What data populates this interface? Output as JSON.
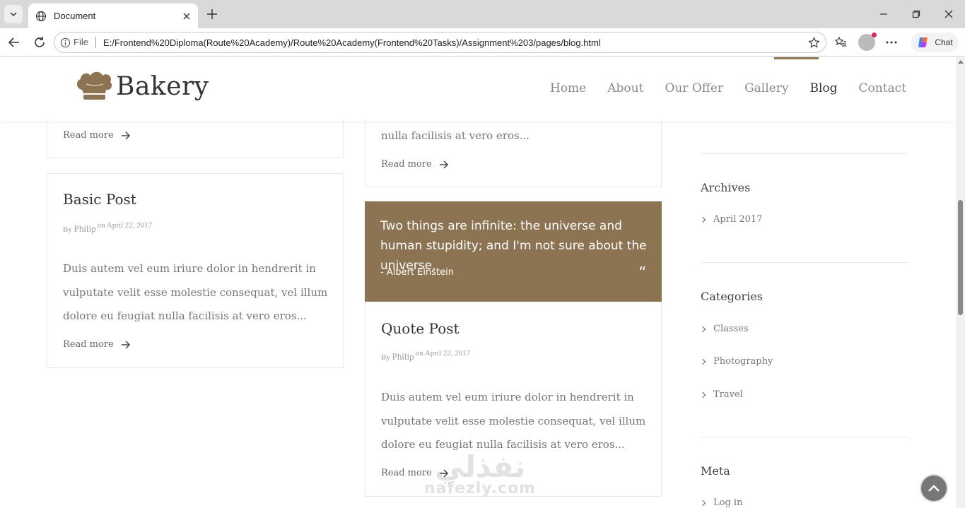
{
  "browser": {
    "tab_title": "Document",
    "address_prefix": "File",
    "url": "E:/Frontend%20Diploma(Route%20Academy)/Route%20Academy(Frontend%20Tasks)/Assignment%203/pages/blog.html",
    "chat_label": "Chat"
  },
  "site": {
    "logo_text": "Bakery",
    "nav": [
      {
        "label": "Home"
      },
      {
        "label": "About"
      },
      {
        "label": "Our Offer"
      },
      {
        "label": "Gallery"
      },
      {
        "label": "Blog",
        "active": true
      },
      {
        "label": "Contact"
      }
    ]
  },
  "posts": {
    "top_left": {
      "read_more": "Read more"
    },
    "top_middle": {
      "excerpt_end": "nulla facilisis at vero eros...",
      "read_more": "Read more"
    },
    "basic": {
      "title": "Basic Post",
      "by": "By",
      "author": "Philip",
      "date": "on April 22, 2017",
      "excerpt": "Duis autem vel eum iriure dolor in hendrerit in vulputate velit esse molestie consequat, vel illum dolore eu feugiat nulla facilisis at vero eros...",
      "read_more": "Read more"
    },
    "quote": {
      "quote_text": "Two things are infinite: the universe and human stupidity; and I'm not sure about the universe.",
      "quote_author": "- Albert Einstein",
      "title": "Quote Post",
      "by": "By",
      "author": "Philip",
      "date": "on April 22, 2017",
      "excerpt": "Duis autem vel eum iriure dolor in hendrerit in vulputate velit esse molestie consequat, vel illum dolore eu feugiat nulla facilisis at vero eros...",
      "read_more": "Read more"
    }
  },
  "sidebar": {
    "archives": {
      "title": "Archives",
      "items": [
        "April 2017"
      ]
    },
    "categories": {
      "title": "Categories",
      "items": [
        "Classes",
        "Photography",
        "Travel"
      ]
    },
    "meta": {
      "title": "Meta",
      "items": [
        "Log in"
      ]
    }
  },
  "watermark": {
    "arabic": "نفذلي",
    "latin": "nafezly.com"
  },
  "colors": {
    "accent": "#8c7351"
  }
}
